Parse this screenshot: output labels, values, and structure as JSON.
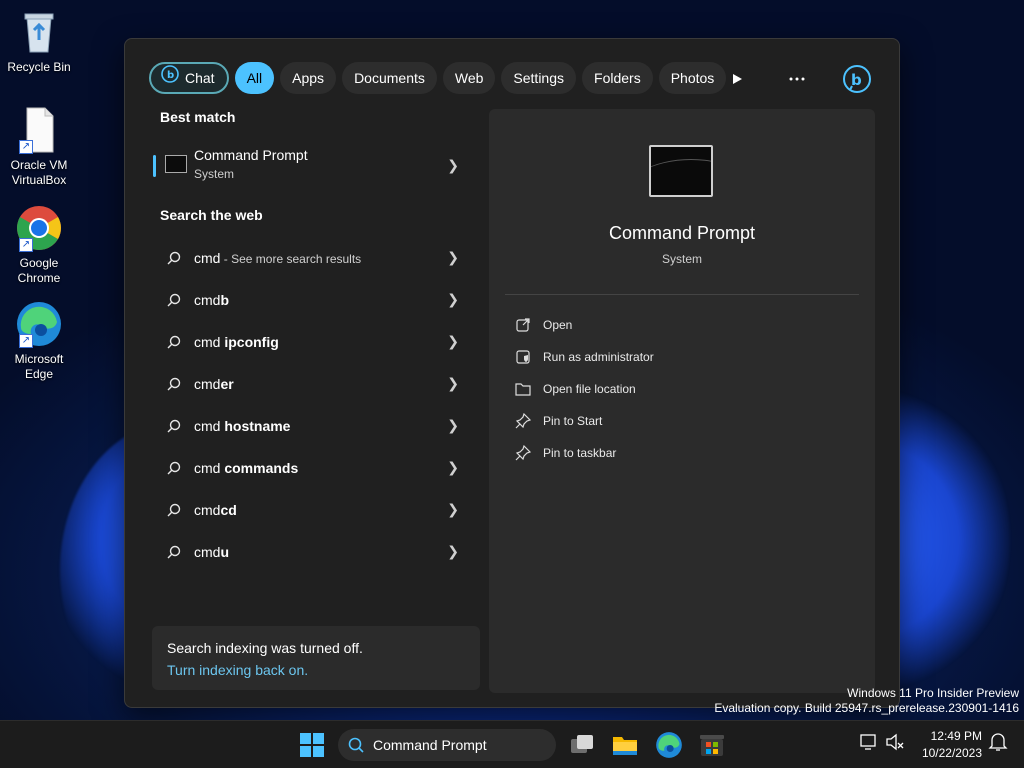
{
  "desktop": {
    "icons": [
      {
        "label": "Recycle Bin"
      },
      {
        "label": "Oracle VM VirtualBox"
      },
      {
        "label": "Google Chrome"
      },
      {
        "label": "Microsoft Edge"
      }
    ],
    "watermark": {
      "line1": "Windows 11 Pro Insider Preview",
      "line2": "Evaluation copy. Build 25947.rs_prerelease.230901-1416"
    }
  },
  "search_panel": {
    "filters": [
      {
        "label": "Chat",
        "icon": "bing-chat-icon"
      },
      {
        "label": "All",
        "active": true
      },
      {
        "label": "Apps"
      },
      {
        "label": "Documents"
      },
      {
        "label": "Web"
      },
      {
        "label": "Settings"
      },
      {
        "label": "Folders"
      },
      {
        "label": "Photos"
      }
    ],
    "best_match_heading": "Best match",
    "best_match": {
      "name": "Command Prompt",
      "type": "System"
    },
    "web_heading": "Search the web",
    "web_results": [
      {
        "term": "cmd",
        "suffix": " - See more search results"
      },
      {
        "term": "cmd",
        "bold": "b"
      },
      {
        "term": "cmd",
        "bold": " ipconfig"
      },
      {
        "term": "cmd",
        "bold": "er"
      },
      {
        "term": "cmd",
        "bold": " hostname"
      },
      {
        "term": "cmd",
        "bold": " commands"
      },
      {
        "term": "cmd",
        "bold": "cd"
      },
      {
        "term": "cmd",
        "bold": "u"
      }
    ],
    "indexing": {
      "message": "Search indexing was turned off.",
      "link": "Turn indexing back on."
    },
    "preview": {
      "name": "Command Prompt",
      "type": "System",
      "actions": [
        {
          "label": "Open",
          "icon": "open-external-icon"
        },
        {
          "label": "Run as administrator",
          "icon": "shield-admin-icon"
        },
        {
          "label": "Open file location",
          "icon": "folder-icon"
        },
        {
          "label": "Pin to Start",
          "icon": "pin-icon"
        },
        {
          "label": "Pin to taskbar",
          "icon": "pin-icon"
        }
      ]
    }
  },
  "taskbar": {
    "search_value": "Command Prompt",
    "time": "12:49 PM",
    "date": "10/22/2023"
  },
  "colors": {
    "accent": "#4cc2ff",
    "panel": "#202020",
    "preview": "#2b2b2b",
    "taskbar": "#1c1c1c"
  }
}
